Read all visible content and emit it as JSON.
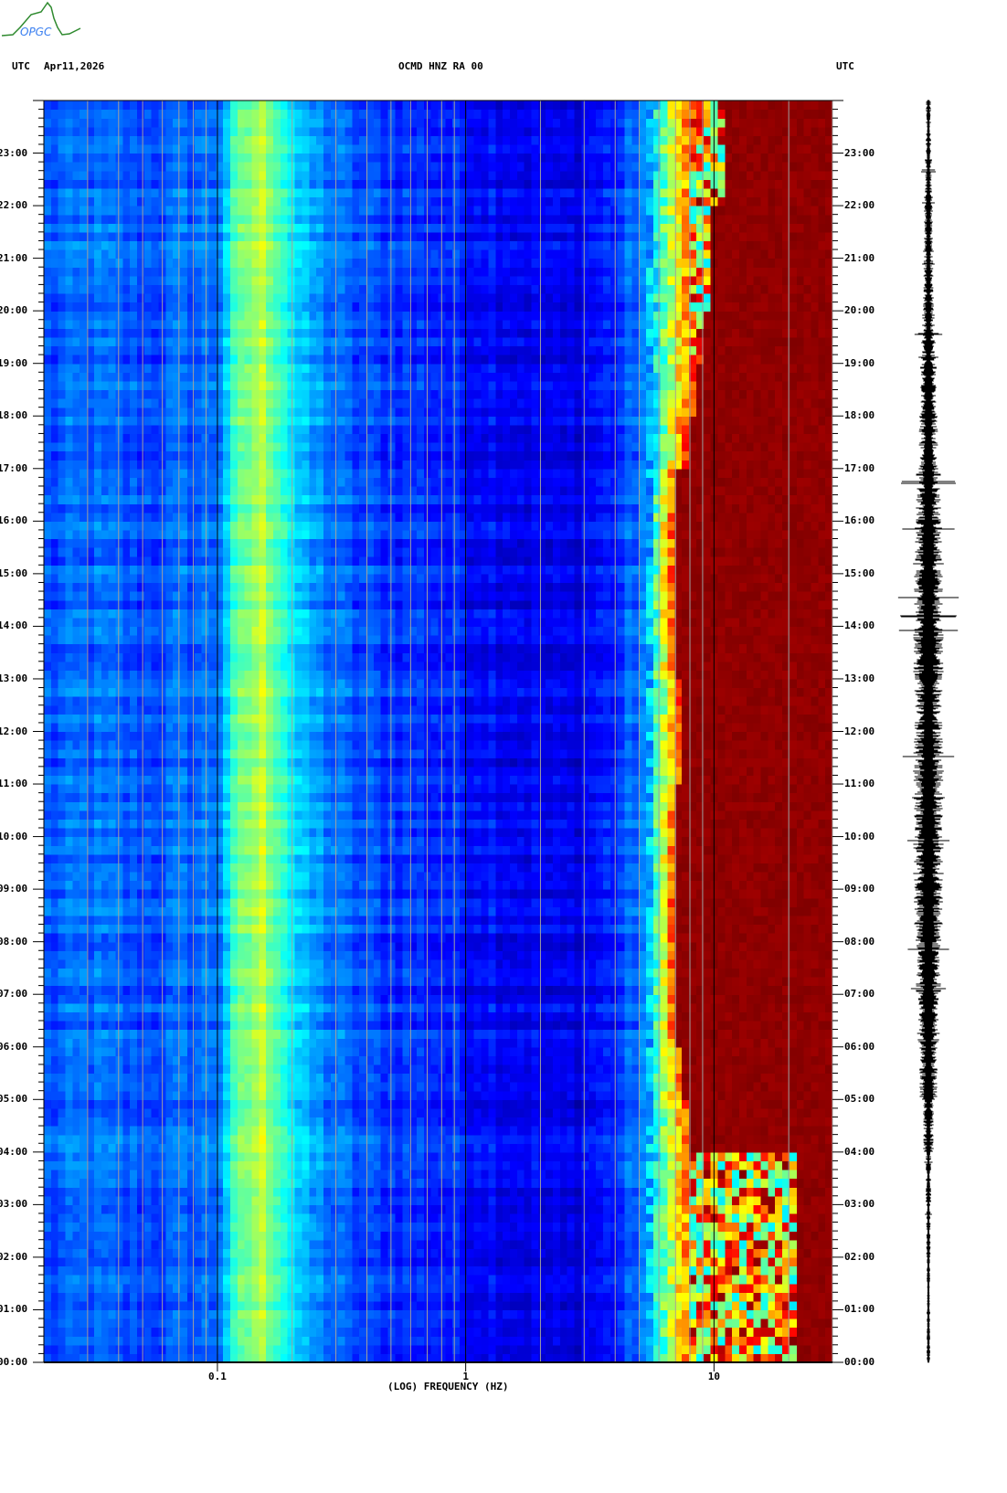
{
  "header": {
    "logo_text": "OPGC",
    "left_tz": "UTC",
    "date": "Apr11,2026",
    "title": "OCMD HNZ RA 00",
    "right_tz": "UTC"
  },
  "chart_data": {
    "type": "heatmap",
    "title": "OCMD HNZ RA 00",
    "xlabel": "(LOG) FREQUENCY (HZ)",
    "ylabel": "UTC",
    "x_scale": "log",
    "xlim": [
      0.02,
      30
    ],
    "x_ticks": [
      {
        "value": 0.1,
        "label": "0.1"
      },
      {
        "value": 1,
        "label": "1"
      },
      {
        "value": 10,
        "label": "10"
      }
    ],
    "ylim_hours": [
      0,
      24
    ],
    "y_ticks": [
      "00:00",
      "01:00",
      "02:00",
      "03:00",
      "04:00",
      "05:00",
      "06:00",
      "07:00",
      "08:00",
      "09:00",
      "10:00",
      "11:00",
      "12:00",
      "13:00",
      "14:00",
      "15:00",
      "16:00",
      "17:00",
      "18:00",
      "19:00",
      "20:00",
      "21:00",
      "22:00",
      "23:00"
    ],
    "y_minor_tick_minutes": 10,
    "colormap": [
      "#00008f",
      "#0000ff",
      "#00ffff",
      "#ffff00",
      "#ff0000",
      "#800000"
    ],
    "frequency_profile": [
      {
        "hz": 0.02,
        "level": 0.2
      },
      {
        "hz": 0.03,
        "level": 0.23
      },
      {
        "hz": 0.05,
        "level": 0.2
      },
      {
        "hz": 0.1,
        "level": 0.24
      },
      {
        "hz": 0.12,
        "level": 0.45
      },
      {
        "hz": 0.15,
        "level": 0.56
      },
      {
        "hz": 0.18,
        "level": 0.45
      },
      {
        "hz": 0.22,
        "level": 0.3
      },
      {
        "hz": 0.35,
        "level": 0.2
      },
      {
        "hz": 1,
        "level": 0.15
      },
      {
        "hz": 2.5,
        "level": 0.09
      },
      {
        "hz": 4,
        "level": 0.16
      },
      {
        "hz": 6,
        "level": 0.32
      },
      {
        "hz": 7.5,
        "level": 0.6
      }
    ],
    "noise_onset_hz_by_hour": [
      21,
      21,
      21,
      21,
      8,
      7.5,
      7,
      7,
      7,
      7,
      7,
      7.5,
      7.5,
      7,
      7,
      7,
      7,
      8,
      8.5,
      9,
      10,
      10,
      11,
      11
    ],
    "mixed_band_hours": [
      0,
      1,
      2,
      3,
      19,
      20,
      21,
      22,
      23
    ],
    "trace_amplitude_by_hour": [
      0.1,
      0.1,
      0.12,
      0.15,
      0.3,
      0.5,
      0.6,
      0.7,
      0.8,
      0.85,
      0.85,
      0.85,
      0.8,
      0.85,
      0.8,
      0.75,
      0.7,
      0.55,
      0.45,
      0.35,
      0.3,
      0.25,
      0.2,
      0.15
    ]
  }
}
